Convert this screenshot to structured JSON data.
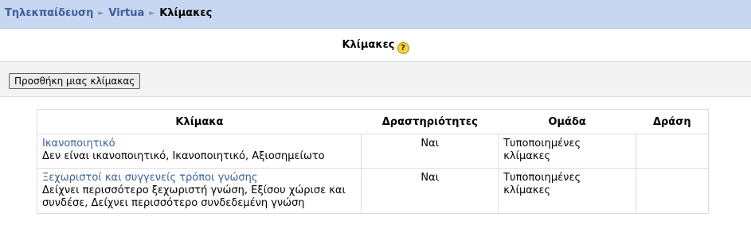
{
  "breadcrumb": {
    "items": [
      "Τηλεκπαίδευση",
      "Virtua"
    ],
    "current": "Κλίμακες",
    "separator": "►"
  },
  "page": {
    "title": "Κλίμακες",
    "help_icon": "help-question-icon"
  },
  "toolbar": {
    "add_scale_label": "Προσθήκη μιας κλίμακας"
  },
  "table": {
    "headers": [
      "Κλίμακα",
      "Δραστηριότητες",
      "Ομάδα",
      "Δράση"
    ],
    "rows": [
      {
        "name": "Ικανοποιητικό",
        "description": "Δεν είναι ικανοποιητικό, Ικανοποιητικό, Αξιοσημείωτο",
        "activities": "Ναι",
        "group": "Τυποποιημένες κλίμακες",
        "action": ""
      },
      {
        "name": "Ξεχωριστοί και συγγενείς τρόποι γνώσης",
        "description": "Δείχνει περισσότερο ξεχωριστή γνώση, Εξίσου χώρισε και συνδέσε, Δείχνει περισσότερο συνδεδεμένη γνώση",
        "activities": "Ναι",
        "group": "Τυποποιημένες κλίμακες",
        "action": ""
      }
    ]
  },
  "colors": {
    "navbar": "#c7d7f2",
    "link": "#3b5f98",
    "button_bar": "#f3f3f3"
  }
}
